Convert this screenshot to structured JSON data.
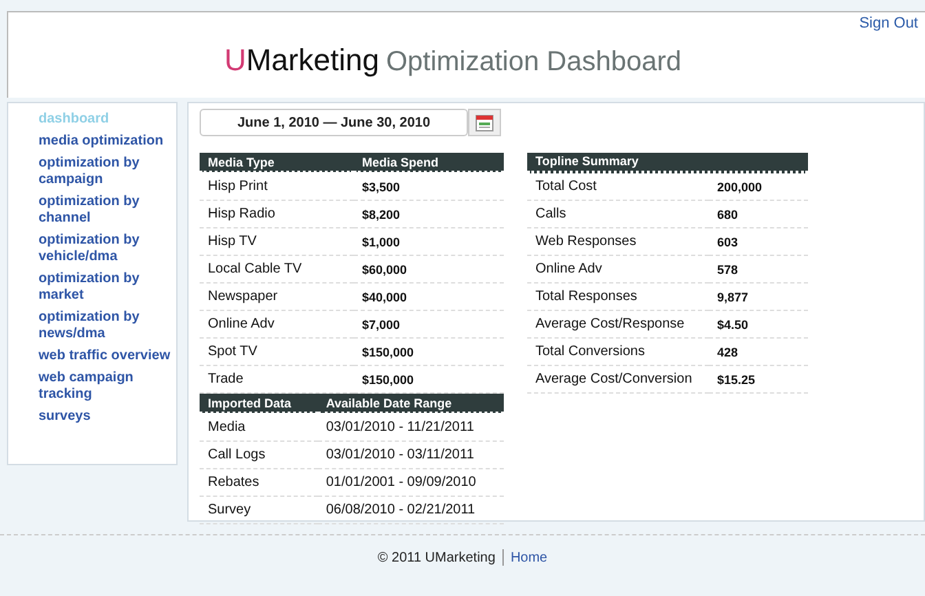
{
  "header": {
    "sign_out": "Sign Out",
    "logo_accent": "U",
    "logo_name": "Marketing",
    "title": "Optimization Dashboard"
  },
  "sidebar": {
    "items": [
      {
        "label": "dashboard",
        "selected": true
      },
      {
        "label": "media optimization",
        "selected": false
      },
      {
        "label": "optimization by campaign",
        "selected": false
      },
      {
        "label": "optimization by channel",
        "selected": false
      },
      {
        "label": "optimization by vehicle/dma",
        "selected": false
      },
      {
        "label": "optimization by market",
        "selected": false
      },
      {
        "label": "optimization by news/dma",
        "selected": false
      },
      {
        "label": "web traffic overview",
        "selected": false
      },
      {
        "label": "web campaign tracking",
        "selected": false
      },
      {
        "label": "surveys",
        "selected": false
      }
    ]
  },
  "date_range": {
    "value": "June 1, 2010 — June 30, 2010"
  },
  "media_table": {
    "columns": [
      "Media Type",
      "Media Spend"
    ],
    "rows": [
      [
        "Hisp Print",
        "$3,500"
      ],
      [
        "Hisp Radio",
        "$8,200"
      ],
      [
        "Hisp TV",
        "$1,000"
      ],
      [
        "Local Cable TV",
        "$60,000"
      ],
      [
        "Newspaper",
        "$40,000"
      ],
      [
        "Online Adv",
        "$7,000"
      ],
      [
        "Spot TV",
        "$150,000"
      ],
      [
        "Trade",
        "$150,000"
      ]
    ]
  },
  "imported_table": {
    "columns": [
      "Imported Data",
      "Available Date Range"
    ],
    "rows": [
      [
        "Media",
        "03/01/2010 - 11/21/2011"
      ],
      [
        "Call Logs",
        "03/01/2010 - 03/11/2011"
      ],
      [
        "Rebates",
        "01/01/2001 - 09/09/2010"
      ],
      [
        "Survey",
        "06/08/2010 - 02/21/2011"
      ]
    ]
  },
  "topline_table": {
    "title": "Topline Summary",
    "rows": [
      [
        "Total Cost",
        "200,000"
      ],
      [
        "Calls",
        "680"
      ],
      [
        "Web Responses",
        "603"
      ],
      [
        "Online Adv",
        "578"
      ],
      [
        "Total Responses",
        "9,877"
      ],
      [
        "Average Cost/Response",
        "$4.50"
      ],
      [
        "Total Conversions",
        "428"
      ],
      [
        "Average Cost/Conversion",
        "$15.25"
      ]
    ]
  },
  "footer": {
    "copyright": "© 2011 UMarketing",
    "home": "Home"
  }
}
